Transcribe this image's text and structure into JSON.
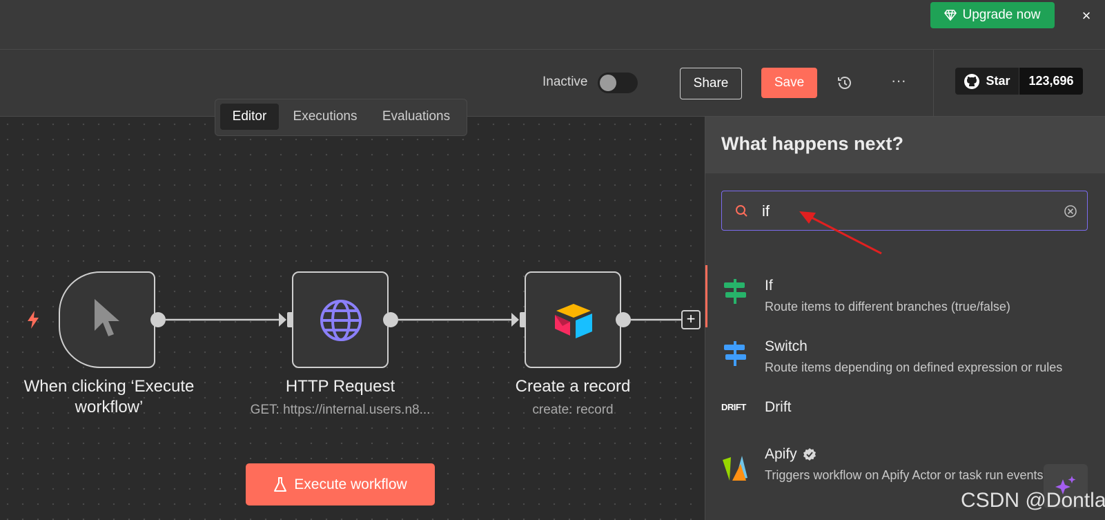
{
  "banner": {
    "upgrade_label": "Upgrade now",
    "close_label": "×"
  },
  "header": {
    "active_label": "Inactive",
    "share_label": "Share",
    "save_label": "Save",
    "more_label": "···",
    "github": {
      "star_label": "Star",
      "count": "123,696"
    }
  },
  "tabs": [
    {
      "label": "Editor",
      "active": true
    },
    {
      "label": "Executions",
      "active": false
    },
    {
      "label": "Evaluations",
      "active": false
    }
  ],
  "nodes": [
    {
      "title": "When clicking ‘Execute workflow’",
      "subtitle": ""
    },
    {
      "title": "HTTP Request",
      "subtitle": "GET: https://internal.users.n8..."
    },
    {
      "title": "Create a record",
      "subtitle": "create: record"
    }
  ],
  "execute_button_label": "Execute workflow",
  "add_node_label": "+",
  "panel": {
    "title": "What happens next?",
    "search_value": "if",
    "results": [
      {
        "name": "If",
        "description": "Route items to different branches (true/false)",
        "icon": "if-signpost-icon"
      },
      {
        "name": "Switch",
        "description": "Route items depending on defined expression or rules",
        "icon": "switch-signpost-icon"
      },
      {
        "name": "Drift",
        "description": "",
        "icon": "drift-logo-icon",
        "logo_text": "DRIFT"
      },
      {
        "name": "Apify",
        "description": "Triggers workflow on Apify Actor or task run events",
        "icon": "apify-logo-icon"
      }
    ]
  },
  "watermark": "CSDN @Dontla",
  "colors": {
    "accent": "#ff6d5a",
    "upgrade": "#1fa256",
    "search_border": "#7c6cf0",
    "http_globe": "#8b80f9"
  }
}
